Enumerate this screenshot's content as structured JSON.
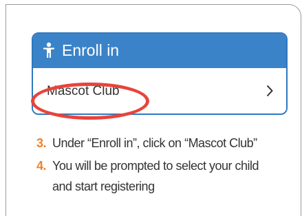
{
  "card": {
    "header_title": "Enroll in",
    "header_icon": "person-icon",
    "row_label": "Mascot Club",
    "row_icon": "chevron-right-icon"
  },
  "colors": {
    "header_blue": "#3b83c8",
    "border_blue": "#2f78bf",
    "highlight_red": "#e8443a",
    "step_number_orange": "#f0822a",
    "text_dark": "#333333"
  },
  "steps": [
    {
      "number": "3.",
      "text": "Under “Enroll in”, click on “Mascot Club”"
    },
    {
      "number": "4.",
      "text": "You will be prompted to select your child and start registering"
    }
  ]
}
